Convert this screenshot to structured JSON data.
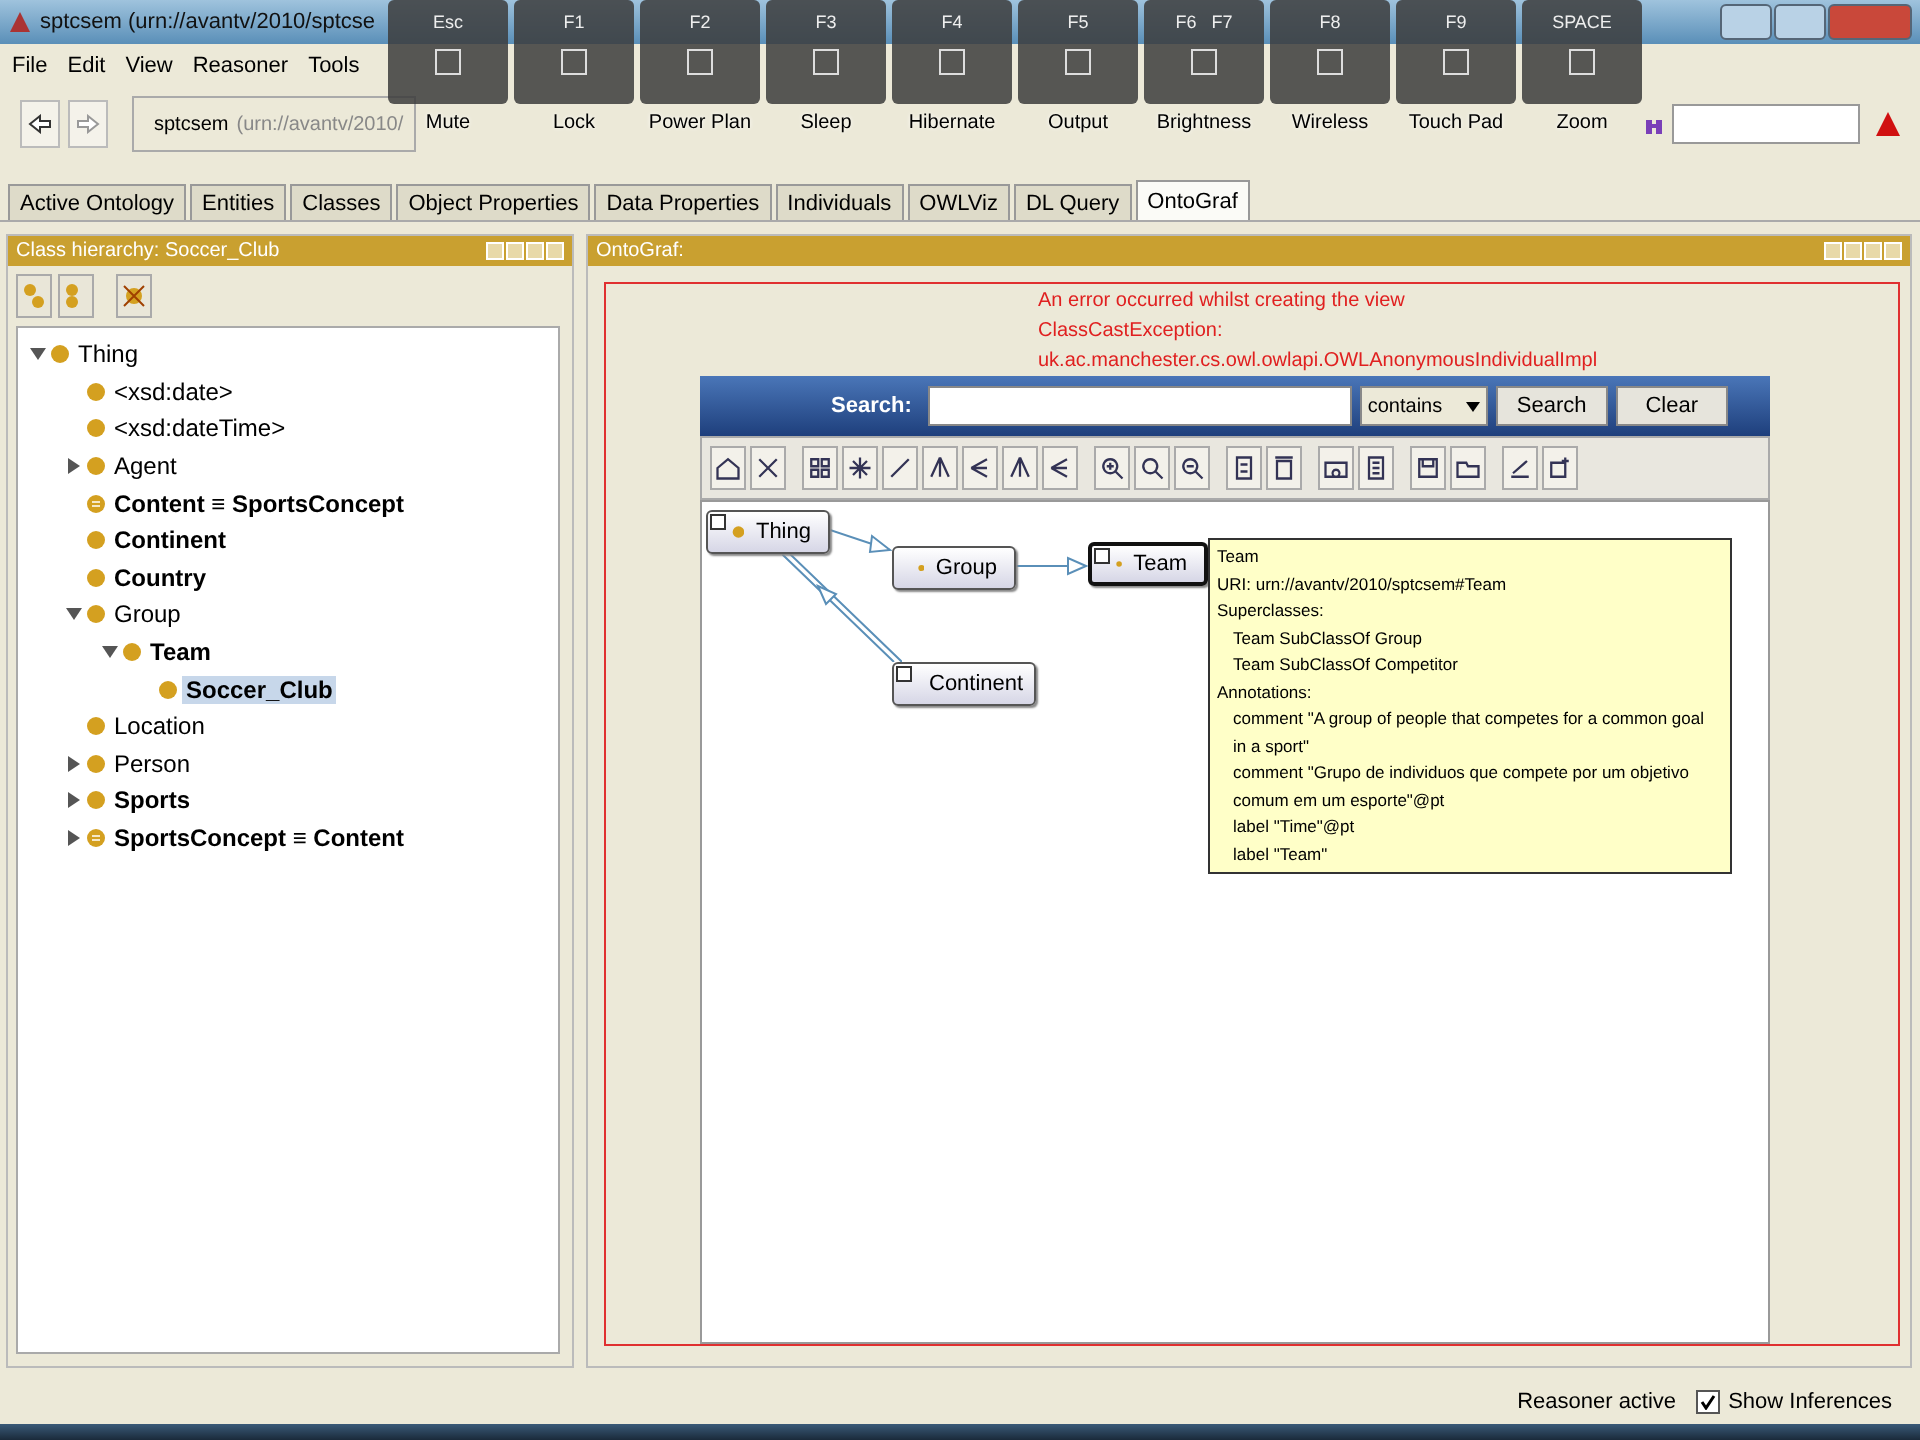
{
  "window": {
    "title": "sptcsem (urn://avantv/2010/sptcse"
  },
  "menu": [
    "File",
    "Edit",
    "View",
    "Reasoner",
    "Tools"
  ],
  "address": {
    "name": "sptcsem",
    "uri": "(urn://avantv/2010/"
  },
  "tabs": [
    {
      "label": "Active Ontology",
      "selected": false
    },
    {
      "label": "Entities",
      "selected": false
    },
    {
      "label": "Classes",
      "selected": false
    },
    {
      "label": "Object Properties",
      "selected": false
    },
    {
      "label": "Data Properties",
      "selected": false
    },
    {
      "label": "Individuals",
      "selected": false
    },
    {
      "label": "OWLViz",
      "selected": false
    },
    {
      "label": "DL Query",
      "selected": false
    },
    {
      "label": "OntoGraf",
      "selected": true
    }
  ],
  "hotkeys": [
    {
      "key": "Esc",
      "label": "Mute"
    },
    {
      "key": "F1",
      "label": "Lock"
    },
    {
      "key": "F2",
      "label": "Power Plan"
    },
    {
      "key": "F3",
      "label": "Sleep"
    },
    {
      "key": "F4",
      "label": "Hibernate"
    },
    {
      "key": "F5",
      "label": "Output"
    },
    {
      "key": "F6   F7",
      "label": "Brightness"
    },
    {
      "key": "F8",
      "label": "Wireless"
    },
    {
      "key": "F9",
      "label": "Touch Pad"
    },
    {
      "key": "SPACE",
      "label": "Zoom"
    }
  ],
  "hierarchy": {
    "title": "Class hierarchy: Soccer_Club",
    "tree": [
      {
        "label": "Thing",
        "expanded": true,
        "bold": false,
        "kind": "class",
        "selected": false,
        "children": [
          {
            "label": "<xsd:date>",
            "bold": false,
            "kind": "class",
            "selected": false
          },
          {
            "label": "<xsd:dateTime>",
            "bold": false,
            "kind": "class",
            "selected": false
          },
          {
            "label": "Agent",
            "expanded": false,
            "bold": false,
            "kind": "class",
            "selected": false
          },
          {
            "label": "Content ≡ SportsConcept",
            "bold": true,
            "kind": "equivalent",
            "selected": false
          },
          {
            "label": "Continent",
            "bold": true,
            "kind": "class",
            "selected": false
          },
          {
            "label": "Country",
            "bold": true,
            "kind": "class",
            "selected": false
          },
          {
            "label": "Group",
            "expanded": true,
            "bold": false,
            "kind": "class",
            "selected": false,
            "children": [
              {
                "label": "Team",
                "expanded": true,
                "bold": true,
                "kind": "class",
                "selected": false,
                "children": [
                  {
                    "label": "Soccer_Club",
                    "bold": true,
                    "kind": "class",
                    "selected": true
                  }
                ]
              }
            ]
          },
          {
            "label": "Location",
            "bold": false,
            "kind": "class",
            "selected": false
          },
          {
            "label": "Person",
            "expanded": false,
            "bold": false,
            "kind": "class",
            "selected": false
          },
          {
            "label": "Sports",
            "expanded": false,
            "bold": true,
            "kind": "class",
            "selected": false
          },
          {
            "label": "SportsConcept ≡ Content",
            "expanded": false,
            "bold": true,
            "kind": "equivalent",
            "selected": false
          }
        ]
      }
    ]
  },
  "ontograf": {
    "title": "OntoGraf:",
    "error": [
      "An error occurred whilst creating the view",
      "ClassCastException:",
      "uk.ac.manchester.cs.owl.owlapi.OWLAnonymousIndividualImpl"
    ],
    "search_label": "Search:",
    "match": "contains",
    "buttons": [
      "Search",
      "Clear"
    ],
    "nodes": [
      {
        "label": "Thing",
        "expandable": true,
        "selected": false
      },
      {
        "label": "Group",
        "expandable": false,
        "selected": false
      },
      {
        "label": "Team",
        "expandable": true,
        "selected": true
      },
      {
        "label": "Continent",
        "expandable": true,
        "selected": false
      }
    ],
    "tooltip": {
      "lines": [
        {
          "text": "Team",
          "indent": false
        },
        {
          "text": "URI:  urn://avantv/2010/sptcsem#Team",
          "indent": false
        },
        {
          "text": "Superclasses:",
          "indent": false
        },
        {
          "text": "Team SubClassOf Group",
          "indent": true
        },
        {
          "text": "Team SubClassOf Competitor",
          "indent": true
        },
        {
          "text": "Annotations:",
          "indent": false
        },
        {
          "text": "comment \"A group of people that competes for a common goal in a sport\"",
          "indent": true
        },
        {
          "text": "comment \"Grupo de individuos que compete por um objetivo comum em um esporte\"@pt",
          "indent": true
        },
        {
          "text": "label \"Time\"@pt",
          "indent": true
        },
        {
          "text": "label \"Team\"",
          "indent": true
        }
      ]
    }
  },
  "status": {
    "reasoner": "Reasoner active",
    "inferences": {
      "label": "Show Inferences",
      "checked": true
    }
  }
}
